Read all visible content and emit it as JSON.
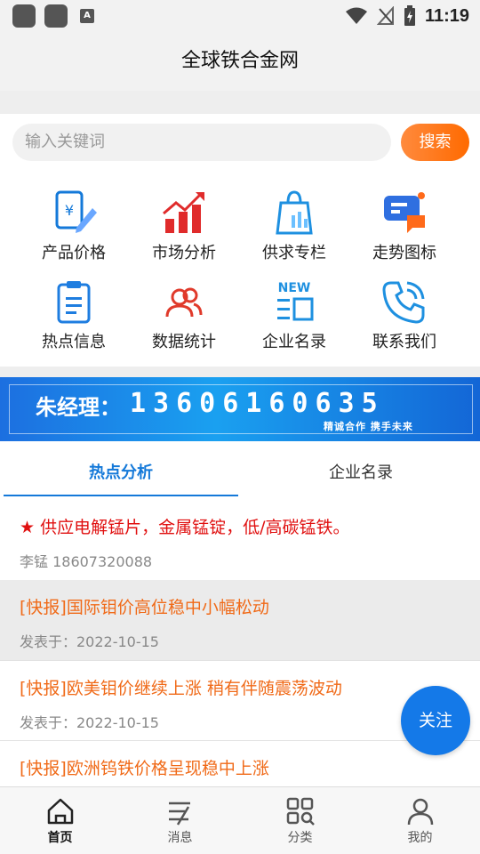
{
  "status_bar": {
    "time": "11:19",
    "app_badge": "A"
  },
  "header": {
    "title": "全球铁合金网"
  },
  "search": {
    "placeholder": "输入关键词",
    "button_label": "搜索"
  },
  "categories": [
    {
      "label": "产品价格",
      "icon": "price-tag-icon"
    },
    {
      "label": "市场分析",
      "icon": "bar-chart-icon"
    },
    {
      "label": "供求专栏",
      "icon": "shopping-bag-icon"
    },
    {
      "label": "走势图标",
      "icon": "chat-chart-icon"
    },
    {
      "label": "热点信息",
      "icon": "clipboard-icon"
    },
    {
      "label": "数据统计",
      "icon": "users-icon"
    },
    {
      "label": "企业名录",
      "icon": "new-badge-icon"
    },
    {
      "label": "联系我们",
      "icon": "phone-icon"
    }
  ],
  "banner": {
    "name": "朱经理：",
    "phone": "13606160635",
    "subtitle": "精诚合作  携手未来"
  },
  "tabs": [
    {
      "label": "热点分析"
    },
    {
      "label": "企业名录"
    }
  ],
  "featured": {
    "title": "★ 供应电解锰片，金属锰锭，低/高碳锰铁。",
    "meta": "李锰 18607320088"
  },
  "news": [
    {
      "title": "[快报]国际钼价高位稳中小幅松动",
      "date": "发表于：2022-10-15"
    },
    {
      "title": "[快报]欧美钼价继续上涨 稍有伴随震荡波动",
      "date": "发表于：2022-10-15"
    },
    {
      "title": "[快报]欧洲钨铁价格呈现稳中上涨",
      "date": ""
    }
  ],
  "follow_button": {
    "label": "关注"
  },
  "bottom_nav": [
    {
      "label": "首页",
      "icon": "home-icon"
    },
    {
      "label": "消息",
      "icon": "message-icon"
    },
    {
      "label": "分类",
      "icon": "category-icon"
    },
    {
      "label": "我的",
      "icon": "profile-icon"
    }
  ],
  "colors": {
    "accent_blue": "#1479d9",
    "search_orange": "#ff7a1a",
    "news_orange": "#f06a18",
    "featured_red": "#e01010"
  }
}
